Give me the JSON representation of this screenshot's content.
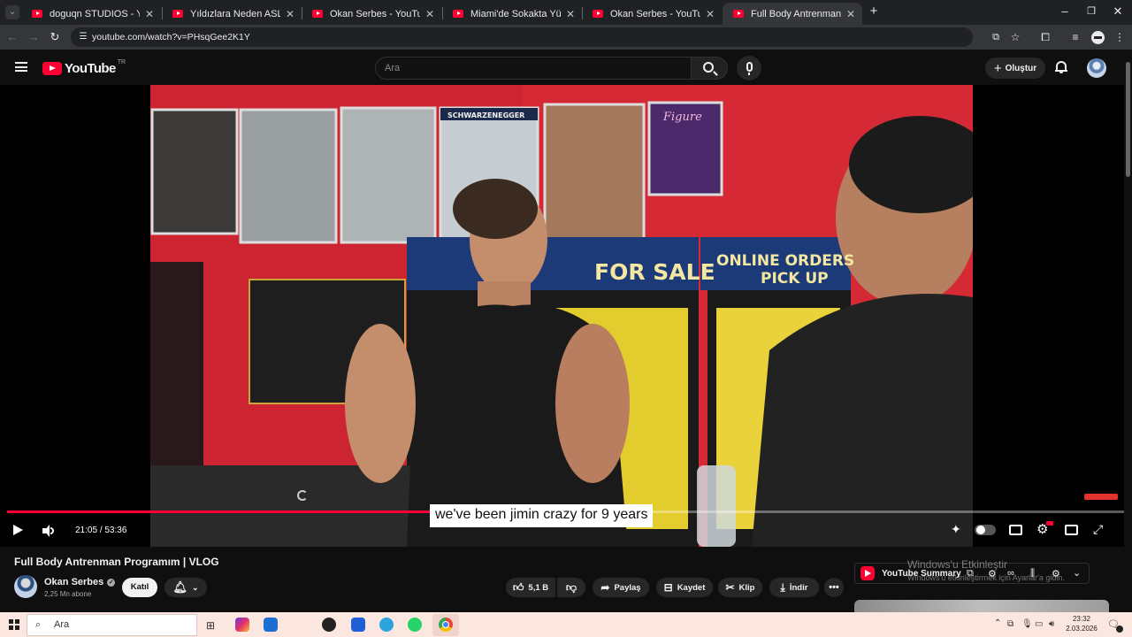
{
  "browser": {
    "tabs": [
      {
        "title": "doguqn STUDIOS - YouTube",
        "active": false
      },
      {
        "title": "Yıldızlara Neden ASLA Gidemey",
        "active": false
      },
      {
        "title": "Okan Serbes - YouTube",
        "active": false
      },
      {
        "title": "Miami'de Sokakta Yürüdüm! | K",
        "active": false
      },
      {
        "title": "Okan Serbes - YouTube",
        "active": false
      },
      {
        "title": "Full Body Antrenman Programı",
        "active": true
      }
    ],
    "url": "youtube.com/watch?v=PHsqGee2K1Y"
  },
  "youtube": {
    "logo_text": "YouTube",
    "region": "TR",
    "search_placeholder": "Ara",
    "create_label": "Oluştur"
  },
  "video": {
    "scene_text": {
      "for_sale": "FOR SALE",
      "online_orders_1": "ONLINE ORDERS",
      "online_orders_2": "PICK UP",
      "poster_name": "SCHWARZENEGGER",
      "figure_poster": "Figure"
    },
    "caption": "we've been jimin crazy for 9 years",
    "time_current": "21:05",
    "time_total": "53:36",
    "progress": 0.3935,
    "title": "Full Body Antrenman Programım | VLOG"
  },
  "channel": {
    "name": "Okan Serbes",
    "subscribers": "2,25 Mn abone",
    "join_label": "Katıl"
  },
  "actions": {
    "likes": "5,1 B",
    "share": "Paylaş",
    "save": "Kaydet",
    "clip": "Klip",
    "download": "İndir"
  },
  "sidebar": {
    "summary_label": "YouTube Summary",
    "windows_notice_1": "Windows'u Etkinleştir",
    "windows_notice_2": "Windows'u etkinleştirmek için Ayarlar'a gidin."
  },
  "taskbar": {
    "search_placeholder": "Ara",
    "time": "23:32",
    "date": "2.03.2026"
  },
  "colors": {
    "accent": "#ff0033",
    "background": "#0f0f0f",
    "taskbar": "#fbe6e0"
  }
}
